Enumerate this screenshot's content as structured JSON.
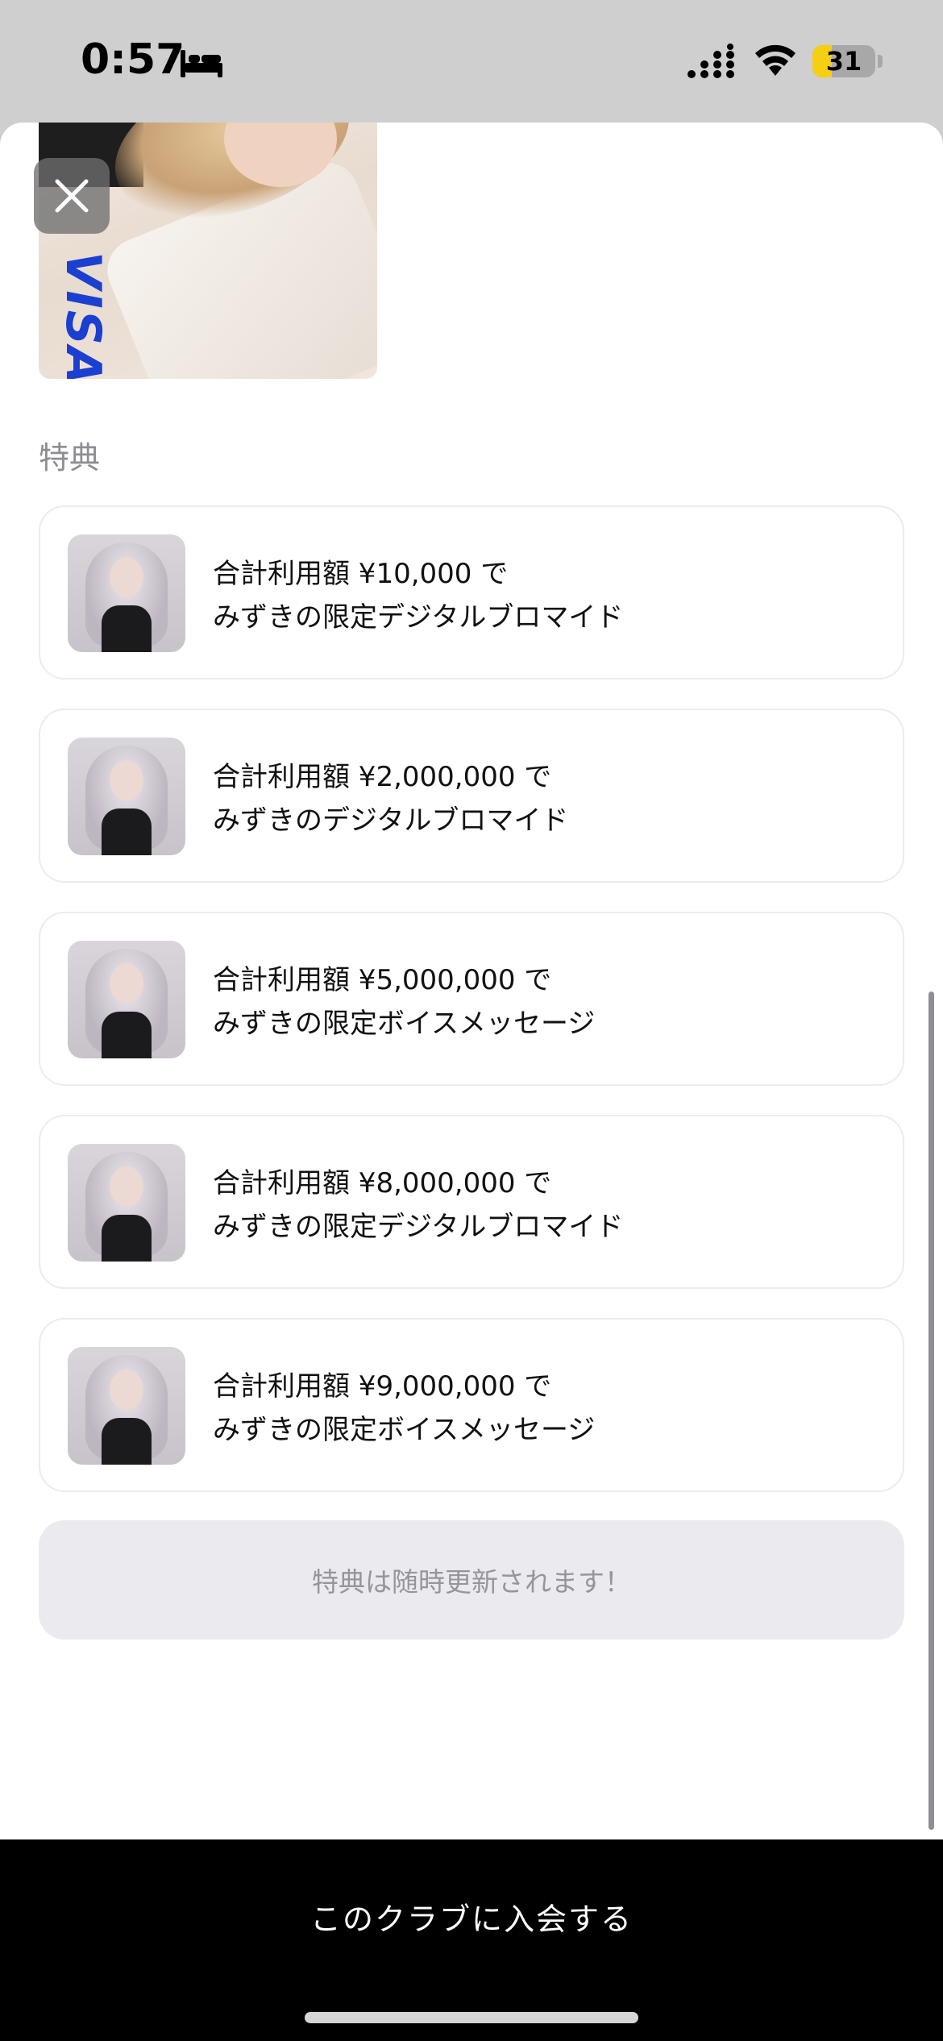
{
  "status_bar": {
    "time": "0:57",
    "battery_level": "31",
    "battery_fraction": 0.31
  },
  "card": {
    "brand": "VISA"
  },
  "perks_section": {
    "title": "特典",
    "items": [
      {
        "line1": "合計利用額 ¥10,000 で",
        "line2": "みずきの限定デジタルブロマイド"
      },
      {
        "line1": "合計利用額 ¥2,000,000 で",
        "line2": "みずきのデジタルブロマイド"
      },
      {
        "line1": "合計利用額 ¥5,000,000 で",
        "line2": "みずきの限定ボイスメッセージ"
      },
      {
        "line1": "合計利用額 ¥8,000,000 で",
        "line2": "みずきの限定デジタルブロマイド"
      },
      {
        "line1": "合計利用額 ¥9,000,000 で",
        "line2": "みずきの限定ボイスメッセージ"
      }
    ],
    "notice": "特典は随時更新されます！"
  },
  "footer": {
    "join_label": "このクラブに入会する"
  },
  "colors": {
    "visa_blue": "#1b3fd0",
    "battery_yellow": "#f5cf12",
    "footer_bg": "#000000"
  }
}
